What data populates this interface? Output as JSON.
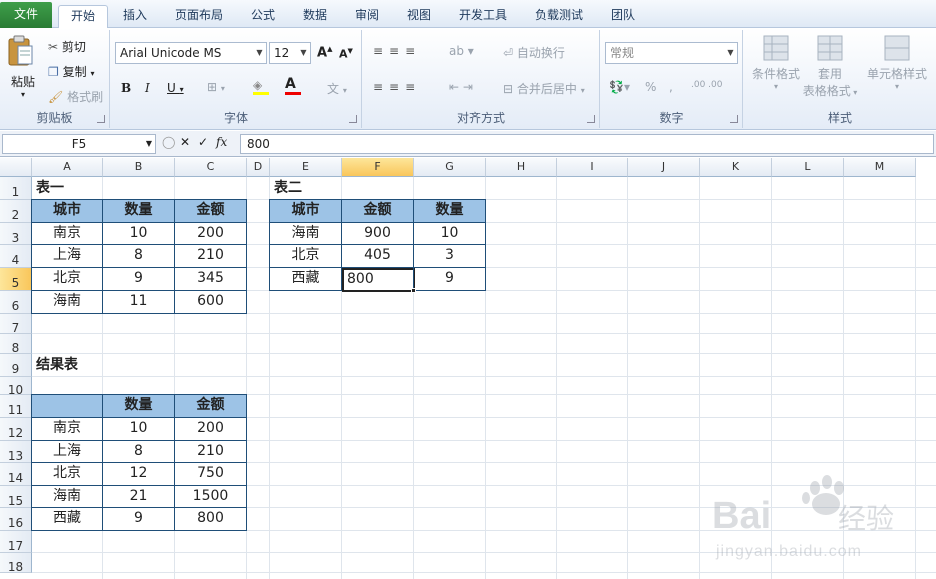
{
  "ribbon": {
    "tabs": [
      "文件",
      "开始",
      "插入",
      "页面布局",
      "公式",
      "数据",
      "审阅",
      "视图",
      "开发工具",
      "负载测试",
      "团队"
    ],
    "active_tab": "开始",
    "clipboard": {
      "paste": "粘贴",
      "cut": "剪切",
      "copy": "复制",
      "format_painter": "格式刷",
      "label": "剪贴板"
    },
    "font": {
      "name": "Arial Unicode MS",
      "size": "12",
      "label": "字体"
    },
    "alignment": {
      "wrap": "自动换行",
      "merge": "合并后居中",
      "label": "对齐方式"
    },
    "number": {
      "format": "常规",
      "label": "数字"
    },
    "styles": {
      "conditional": "条件格式",
      "table_format_1": "套用",
      "table_format_2": "表格格式",
      "cell_styles": "单元格样式",
      "label": "样式"
    }
  },
  "formula_bar": {
    "name_box": "F5",
    "fx": "fx",
    "value": "800"
  },
  "sheet": {
    "columns": [
      "A",
      "B",
      "C",
      "D",
      "E",
      "F",
      "G",
      "H",
      "I",
      "J",
      "K",
      "L",
      "M"
    ],
    "rows": [
      "1",
      "2",
      "3",
      "4",
      "5",
      "6",
      "7",
      "8",
      "9",
      "10",
      "11",
      "12",
      "13",
      "14",
      "15",
      "16",
      "17",
      "18"
    ],
    "selected_col": "F",
    "selected_row": "5"
  },
  "table1": {
    "title": "表一",
    "headers": [
      "城市",
      "数量",
      "金额"
    ],
    "rows": [
      [
        "南京",
        "10",
        "200"
      ],
      [
        "上海",
        "8",
        "210"
      ],
      [
        "北京",
        "9",
        "345"
      ],
      [
        "海南",
        "11",
        "600"
      ]
    ]
  },
  "table2": {
    "title": "表二",
    "headers": [
      "城市",
      "金额",
      "数量"
    ],
    "rows": [
      [
        "海南",
        "900",
        "10"
      ],
      [
        "北京",
        "405",
        "3"
      ],
      [
        "西藏",
        "800",
        "9"
      ]
    ]
  },
  "result": {
    "title": "结果表",
    "headers": [
      "",
      "数量",
      "金额"
    ],
    "rows": [
      [
        "南京",
        "10",
        "200"
      ],
      [
        "上海",
        "8",
        "210"
      ],
      [
        "北京",
        "12",
        "750"
      ],
      [
        "海南",
        "21",
        "1500"
      ],
      [
        "西藏",
        "9",
        "800"
      ]
    ]
  },
  "watermark": {
    "brand": "Bai",
    "brand2": "du",
    "suffix": "经验",
    "url": "jingyan.baidu.com"
  }
}
